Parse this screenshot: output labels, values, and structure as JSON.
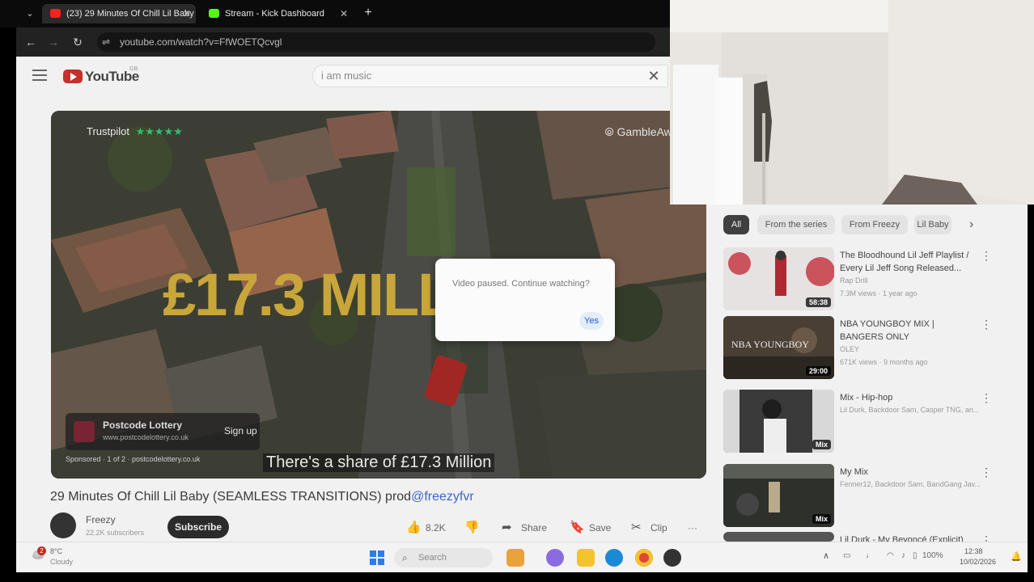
{
  "browser": {
    "tabs": [
      {
        "title": "(23) 29 Minutes Of Chill Lil Baby",
        "favicon_color": "#ff2020"
      },
      {
        "title": "Stream - Kick Dashboard",
        "favicon_color": "#53fc18"
      }
    ],
    "tab_close": "✕",
    "new_tab": "+",
    "tab_list": "⌄",
    "back": "←",
    "forward": "→",
    "reload": "↻",
    "tune": "⇌",
    "url": "youtube.com/watch?v=FfWOETQcvgl"
  },
  "youtube": {
    "logo_text": "YouTube",
    "logo_region": "GB",
    "search_value": "i am music",
    "search_clear": "✕"
  },
  "video": {
    "trustpilot": "Trustpilot",
    "trustpilot_stars": "★★★★★",
    "gamble_aware": "⦾ GambleAware",
    "big_text": "£17.3 MILL",
    "caption": "There's a share of £17.3 Million",
    "ad": {
      "name": "Postcode Lottery",
      "url": "www.postcodelottery.co.uk",
      "signup": "Sign up",
      "info": "Sponsored · 1 of 2 · postcodelottery.co.uk"
    },
    "dialog": {
      "text": "Video paused. Continue watching?",
      "yes": "Yes"
    }
  },
  "watch": {
    "title_prefix": "29 Minutes Of Chill Lil Baby (SEAMLESS TRANSITIONS) prod",
    "title_tag": "@freezyfvr",
    "channel_name": "Freezy",
    "channel_subs": "22.2K subscribers",
    "subscribe": "Subscribe",
    "likes": "8.2K",
    "share": "Share",
    "save": "Save",
    "clip": "Clip",
    "more": "···",
    "icons": {
      "like": "👍",
      "dislike": "👎",
      "share": "➦",
      "save": "🔖",
      "clip": "✂"
    }
  },
  "sidebar": {
    "chips": [
      "All",
      "From the series",
      "From Freezy",
      "Lil Baby"
    ],
    "chip_next": "›",
    "recommendations": [
      {
        "title": "The Bloodhound Lil Jeff Playlist / Every Lil Jeff Song Released...",
        "channel": "Rap Drill",
        "meta": "7.3M views · 1 year ago",
        "badge": "58:38",
        "thumb_color": "#d9cfcf"
      },
      {
        "title": "NBA YOUNGBOY MIX | BANGERS ONLY",
        "channel": "OLEY",
        "meta": "671K views · 9 months ago",
        "badge": "29:00",
        "thumb_color": "#5a4a3c",
        "thumb_text": "NBA YOUNGBOY"
      },
      {
        "title": "Mix - Hip-hop",
        "channel": "",
        "meta": "Lil Durk, Backdoor Sam, Casper TNG, an...",
        "badge": "Mix",
        "thumb_color": "#6e6e6e"
      },
      {
        "title": "My Mix",
        "channel": "",
        "meta": "Fenner12, Backdoor Sam, BandGang Jav...",
        "badge": "Mix",
        "thumb_color": "#3c3f3a"
      },
      {
        "title": "Lil Durk - My Beyoncé (Explicit)",
        "channel": "",
        "meta": "",
        "badge": "",
        "thumb_color": "#444"
      }
    ],
    "kebab": "⋮"
  },
  "taskbar": {
    "weather_temp": "8°C",
    "weather_cond": "Cloudy",
    "weather_badge": "2",
    "search_placeholder": "Search",
    "search_icon": "⌕",
    "tray_arrow": "∧",
    "battery": "100%",
    "time": "12:38",
    "date": "10/02/2026",
    "notify": "🔔",
    "apps": [
      {
        "name": "sunglasses-app",
        "color": "#e8a33a"
      },
      {
        "name": "copilot-app",
        "color": "#8a6be0"
      },
      {
        "name": "file-explorer-app",
        "color": "#f4c430"
      },
      {
        "name": "edge-app",
        "color": "#1b8ad6"
      },
      {
        "name": "chrome-app",
        "color": "#e04535"
      },
      {
        "name": "obs-app",
        "color": "#333333"
      }
    ]
  },
  "colors": {
    "youtube_red": "#c4302b",
    "link_blue": "#3b67c9",
    "dialog_yes": "#1a5cd8",
    "kick_green": "#53fc18"
  }
}
